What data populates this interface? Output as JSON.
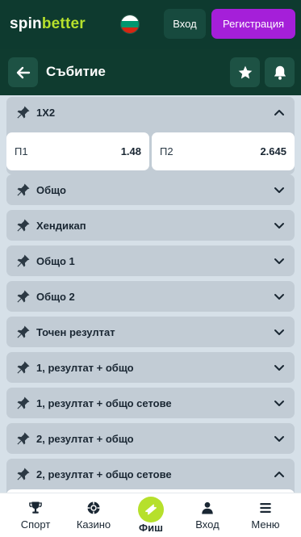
{
  "brand": {
    "logo_part1": "spin",
    "logo_part2": "better"
  },
  "topbar": {
    "login_label": "Вход",
    "register_label": "Регистрация"
  },
  "header": {
    "title": "Събитие"
  },
  "markets": [
    {
      "title": "1X2",
      "expanded": true
    },
    {
      "title": "Общо",
      "expanded": false
    },
    {
      "title": "Хендикап",
      "expanded": false
    },
    {
      "title": "Общо 1",
      "expanded": false
    },
    {
      "title": "Общо 2",
      "expanded": false
    },
    {
      "title": "Точен резултат",
      "expanded": false
    },
    {
      "title": "1, резултат + общо",
      "expanded": false
    },
    {
      "title": "1, резултат + общо сетове",
      "expanded": false
    },
    {
      "title": "2, резултат + общо",
      "expanded": false
    },
    {
      "title": "2, резултат + общо сетове",
      "expanded": true
    }
  ],
  "odds": [
    {
      "label": "П1",
      "value": "1.48"
    },
    {
      "label": "П2",
      "value": "2.645"
    }
  ],
  "bottom_nav": [
    {
      "label": "Спорт",
      "icon": "trophy-icon"
    },
    {
      "label": "Казино",
      "icon": "casino-chip-icon"
    },
    {
      "label": "Фиш",
      "icon": "ticket-icon"
    },
    {
      "label": "Вход",
      "icon": "user-icon"
    },
    {
      "label": "Меню",
      "icon": "menu-icon"
    }
  ],
  "colors": {
    "header_bg": "#0e3a2f",
    "accent_green": "#b6e02c",
    "register_purple": "#a51fd9",
    "panel_bg": "#c2ccd5",
    "page_bg": "#d6e0e8"
  }
}
